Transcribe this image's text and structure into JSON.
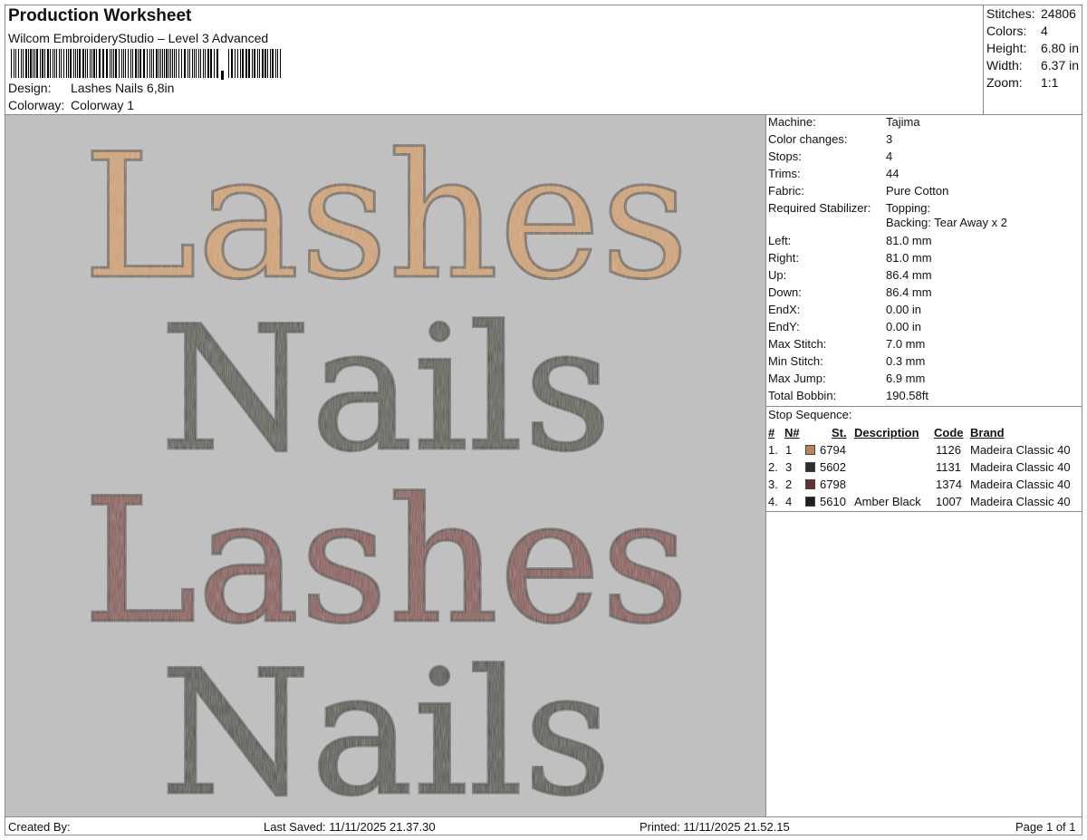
{
  "header": {
    "title": "Production Worksheet",
    "subtitle": "Wilcom EmbroideryStudio – Level 3 Advanced",
    "design_label": "Design:",
    "design_value": "Lashes Nails 6,8in",
    "colorway_label": "Colorway:",
    "colorway_value": "Colorway 1"
  },
  "stats": [
    {
      "label": "Stitches:",
      "value": "24806"
    },
    {
      "label": "Colors:",
      "value": "4"
    },
    {
      "label": "Height:",
      "value": "6.80 in"
    },
    {
      "label": "Width:",
      "value": "6.37 in"
    },
    {
      "label": "Zoom:",
      "value": "1:1"
    }
  ],
  "preview": {
    "lines": [
      {
        "text": "Lashes",
        "color": "#d4a574"
      },
      {
        "text": "Nails",
        "color": "#5f5d52"
      },
      {
        "text": "Lashes",
        "color": "#8a5a55"
      },
      {
        "text": "Nails",
        "color": "#56594f"
      }
    ],
    "background": "#c0c0c0"
  },
  "machine_info": [
    {
      "label": "Machine:",
      "value": "Tajima"
    },
    {
      "label": "Color changes:",
      "value": "3"
    },
    {
      "label": "Stops:",
      "value": "4"
    },
    {
      "label": "Trims:",
      "value": "44"
    },
    {
      "label": "Fabric:",
      "value": "Pure Cotton"
    },
    {
      "label": "Required Stabilizer:",
      "value": "Topping:",
      "value2": "Backing: Tear Away x 2"
    },
    {
      "label": "Left:",
      "value": "81.0 mm"
    },
    {
      "label": "Right:",
      "value": "81.0 mm"
    },
    {
      "label": "Up:",
      "value": "86.4 mm"
    },
    {
      "label": "Down:",
      "value": "86.4 mm"
    },
    {
      "label": "EndX:",
      "value": "0.00 in"
    },
    {
      "label": "EndY:",
      "value": "0.00 in"
    },
    {
      "label": "Max Stitch:",
      "value": "7.0 mm"
    },
    {
      "label": "Min Stitch:",
      "value": "0.3 mm"
    },
    {
      "label": "Max Jump:",
      "value": "6.9 mm"
    },
    {
      "label": "Total Bobbin:",
      "value": "190.58ft"
    }
  ],
  "stop_sequence": {
    "title": "Stop Sequence:",
    "headers": {
      "num": "#",
      "n": "N#",
      "st": "St.",
      "description": "Description",
      "code": "Code",
      "brand": "Brand"
    },
    "rows": [
      {
        "num": "1.",
        "n": "1",
        "swatch": "#b9835e",
        "st": "6794",
        "description": "",
        "code": "1126",
        "brand": "Madeira Classic 40"
      },
      {
        "num": "2.",
        "n": "3",
        "swatch": "#2e2e2c",
        "st": "5602",
        "description": "",
        "code": "1131",
        "brand": "Madeira Classic 40"
      },
      {
        "num": "3.",
        "n": "2",
        "swatch": "#6a2e2e",
        "st": "6798",
        "description": "",
        "code": "1374",
        "brand": "Madeira Classic 40"
      },
      {
        "num": "4.",
        "n": "4",
        "swatch": "#1f1f1f",
        "st": "5610",
        "description": "Amber Black",
        "code": "1007",
        "brand": "Madeira Classic 40"
      }
    ]
  },
  "footer": {
    "created_by": "Created By:",
    "last_saved": "Last Saved: 11/11/2025 21.37.30",
    "printed": "Printed: 11/11/2025 21.52.15",
    "page": "Page 1 of 1"
  }
}
